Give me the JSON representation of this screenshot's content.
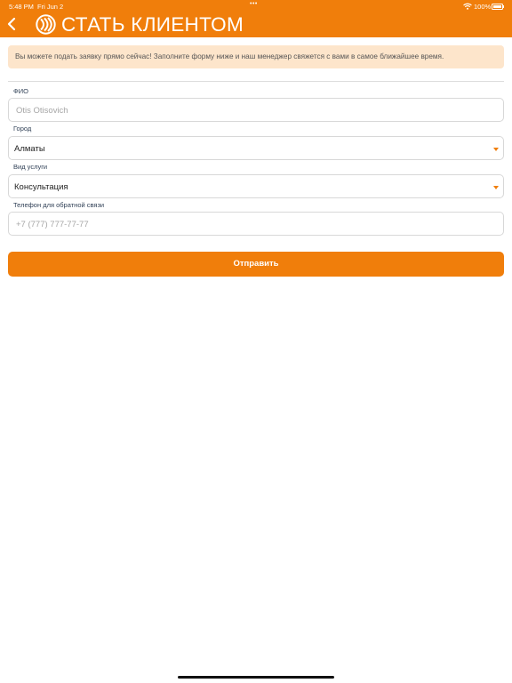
{
  "status_bar": {
    "time": "5:48 PM",
    "date": "Fri Jun 2",
    "battery": "100%"
  },
  "header": {
    "title": "СТАТЬ КЛИЕНТОМ",
    "back_icon": "chevron-left-icon",
    "logo_icon": "brand-logo-icon"
  },
  "info_text": "Вы можете подать заявку прямо сейчас! Заполните форму ниже и наш менеджер свяжется с вами в самое ближайшее время.",
  "form": {
    "name": {
      "label": "ФИО",
      "placeholder": "Otis Otisovich",
      "value": ""
    },
    "city": {
      "label": "Город",
      "value": "Алматы"
    },
    "service": {
      "label": "Вид услуги",
      "value": "Консультация"
    },
    "phone": {
      "label": "Телефон для обратной связи",
      "placeholder": "+7 (777) 777-77-77",
      "value": ""
    }
  },
  "submit_label": "Отправить",
  "colors": {
    "accent": "#f07e0b",
    "info_bg": "#fde5cb",
    "label": "#2f3f55"
  }
}
